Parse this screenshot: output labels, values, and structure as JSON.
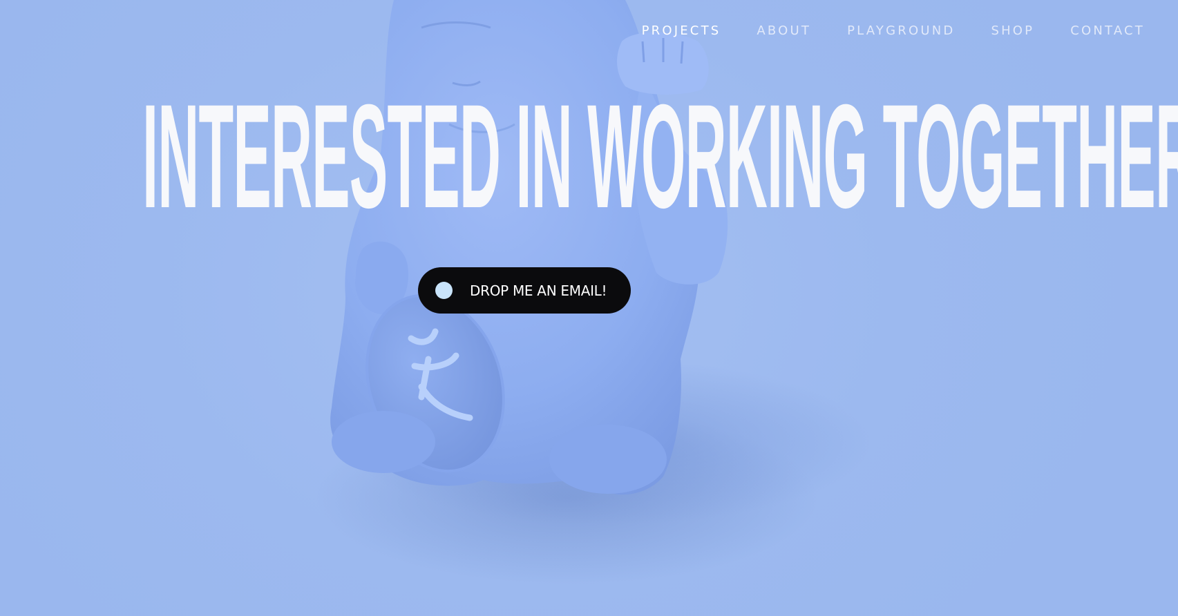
{
  "nav": {
    "items": [
      {
        "label": "PROJECTS",
        "active": true
      },
      {
        "label": "ABOUT",
        "active": false
      },
      {
        "label": "PLAYGROUND",
        "active": false
      },
      {
        "label": "SHOP",
        "active": false
      },
      {
        "label": "CONTACT",
        "active": false
      }
    ]
  },
  "hero": {
    "headline": "INTERESTED IN WORKING TOGETHER?",
    "cta_label": "DROP ME AN EMAIL!"
  },
  "colors": {
    "background": "#9cb9ef",
    "figurine": "#8fb0f0",
    "headline": "#f7f8fb",
    "cta_background": "#0b0b0d",
    "cta_dot": "#c9e4fb"
  },
  "icons": {
    "cta_dot": "circle-dot-icon",
    "background_figure": "lucky-cat-figurine"
  }
}
